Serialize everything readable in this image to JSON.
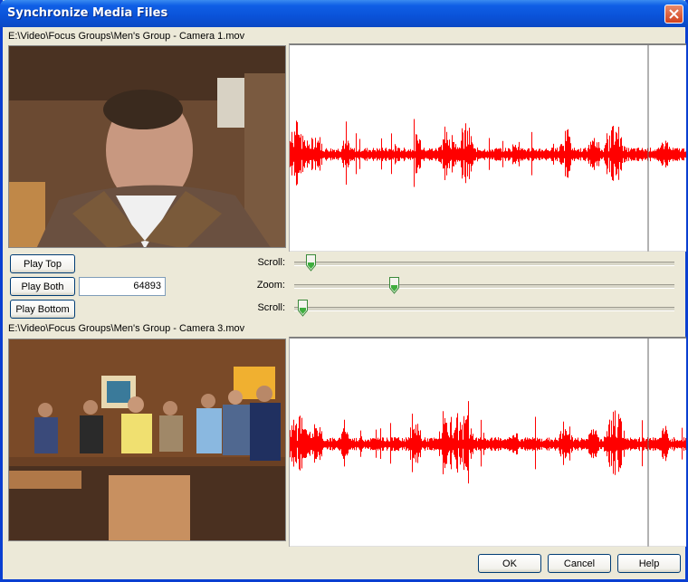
{
  "window": {
    "title": "Synchronize Media Files"
  },
  "top": {
    "path": "E:\\Video\\Focus Groups\\Men's Group - Camera 1.mov"
  },
  "bottom": {
    "path": "E:\\Video\\Focus Groups\\Men's Group - Camera 3.mov"
  },
  "controls": {
    "play_top": "Play Top",
    "play_both": "Play Both",
    "play_bottom": "Play Bottom",
    "offset_value": "64893",
    "scroll_top_label": "Scroll:",
    "zoom_label": "Zoom:",
    "scroll_bottom_label": "Scroll:",
    "scroll_top_level": 0.03,
    "zoom_level": 0.25,
    "scroll_bottom_level": 0.01
  },
  "footer": {
    "ok": "OK",
    "cancel": "Cancel",
    "help": "Help"
  },
  "colors": {
    "waveform": "#ff0000",
    "title_bar": "#0a52d8",
    "dialog_bg": "#ece9d8"
  },
  "icons": {
    "close": "close-icon",
    "slider_thumb": "slider-thumb-icon"
  }
}
